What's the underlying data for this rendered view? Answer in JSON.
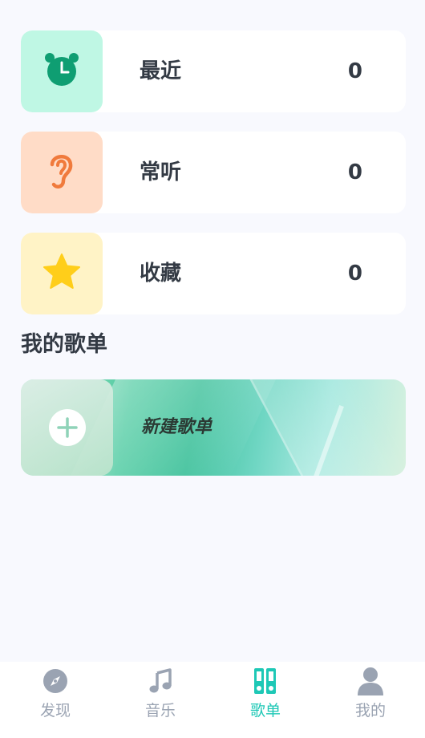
{
  "stats": [
    {
      "label": "最近",
      "count": "0",
      "icon": "alarm-clock-icon",
      "tile_color": "#bff7e4",
      "icon_color": "#0f9e72"
    },
    {
      "label": "常听",
      "count": "0",
      "icon": "ear-icon",
      "tile_color": "#ffdcc7",
      "icon_color": "#f07a3c"
    },
    {
      "label": "收藏",
      "count": "0",
      "icon": "star-icon",
      "tile_color": "#fff3c6",
      "icon_color": "#ffce1a"
    }
  ],
  "section": {
    "title": "我的歌单"
  },
  "new_playlist": {
    "label": "新建歌单",
    "icon": "plus-icon"
  },
  "tabs": [
    {
      "label": "发现",
      "icon": "compass-icon",
      "active": false
    },
    {
      "label": "音乐",
      "icon": "music-note-icon",
      "active": false
    },
    {
      "label": "歌单",
      "icon": "playlist-icon",
      "active": true
    },
    {
      "label": "我的",
      "icon": "user-icon",
      "active": false
    }
  ],
  "colors": {
    "accent": "#1ec8b6",
    "inactive": "#9aa3b2",
    "background": "#f8f9fe"
  }
}
